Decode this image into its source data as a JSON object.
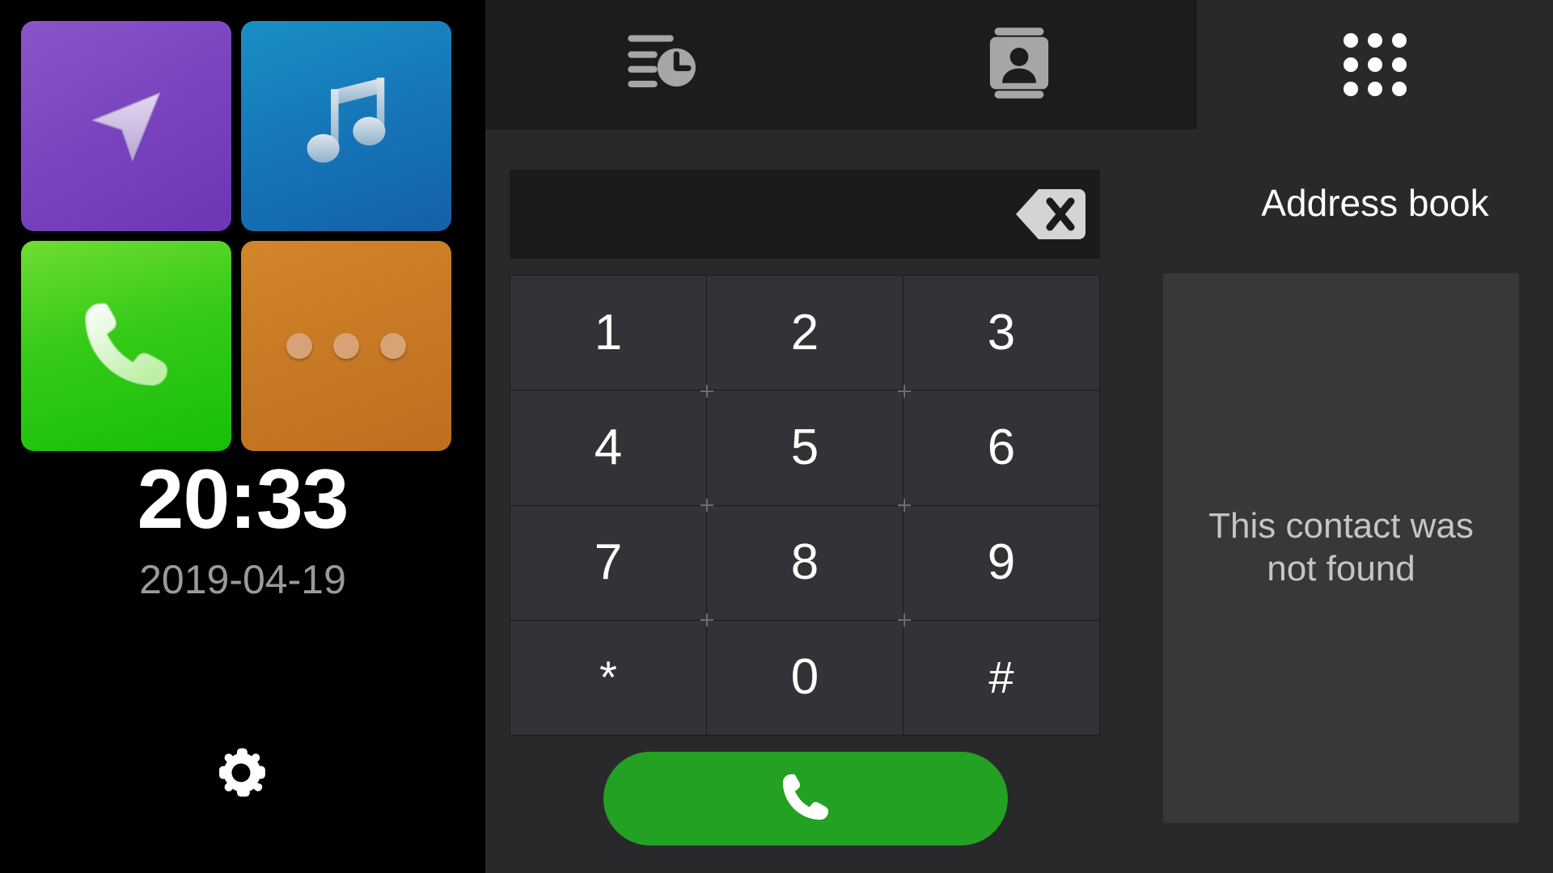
{
  "launcher": {
    "tiles": [
      {
        "name": "navigation",
        "icon": "navigation-arrow-icon",
        "color": "#7b45c0"
      },
      {
        "name": "music",
        "icon": "music-note-icon",
        "color": "#1576b8"
      },
      {
        "name": "phone",
        "icon": "phone-handset-icon",
        "color": "#35ca18"
      },
      {
        "name": "more",
        "icon": "more-dots-icon",
        "color": "#c87a24"
      }
    ],
    "clock": "20:33",
    "date": "2019-04-19",
    "settings_icon": "gear-icon"
  },
  "topbar": {
    "tabs": [
      {
        "name": "call-history",
        "icon": "call-history-icon"
      },
      {
        "name": "contacts",
        "icon": "contact-card-icon"
      }
    ],
    "apps_button": {
      "name": "apps-grid",
      "icon": "apps-grid-icon"
    }
  },
  "dialer": {
    "number_value": "",
    "number_placeholder": "",
    "backspace_icon": "backspace-icon",
    "keys": [
      "1",
      "2",
      "3",
      "4",
      "5",
      "6",
      "7",
      "8",
      "9",
      "*",
      "0",
      "#"
    ],
    "call_button": {
      "label": "",
      "icon": "phone-handset-icon",
      "color": "#23a122"
    }
  },
  "address_book": {
    "title": "Address book",
    "message": "This contact was not found"
  },
  "colors": {
    "background": "#29282b",
    "panel_dark": "#1c1b1e",
    "key": "#333236",
    "card": "#38373a",
    "accent_green": "#23a122",
    "text_primary": "#ffffff",
    "text_muted": "#9a9a9a"
  }
}
